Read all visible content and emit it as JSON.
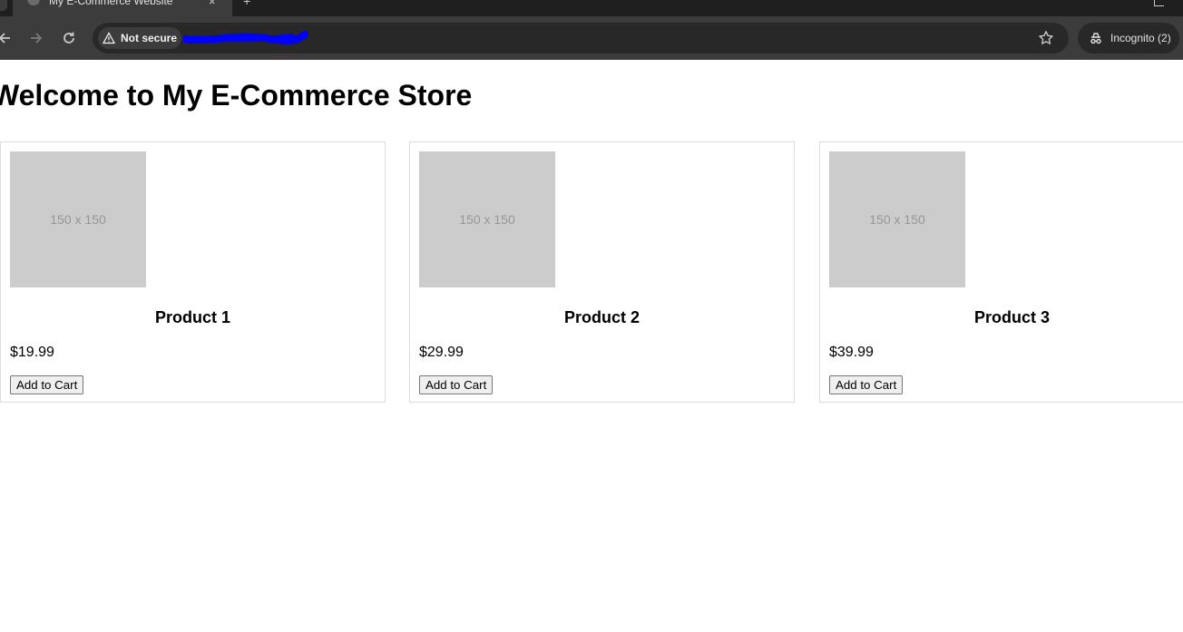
{
  "browser": {
    "tab_title": "My E-Commerce Website",
    "tab_close_glyph": "×",
    "new_tab_glyph": "+",
    "security_label": "Not secure",
    "incognito_label": "Incognito (2)",
    "icons": [
      "back-arrow-icon",
      "forward-arrow-icon",
      "reload-icon",
      "warning-icon",
      "star-icon",
      "incognito-icon"
    ]
  },
  "page": {
    "title": "Welcome to My E-Commerce Store",
    "image_placeholder_text": "150 x 150",
    "image_placeholder_color": "#cccccc",
    "products": [
      {
        "name": "Product 1",
        "price": "$19.99",
        "button_label": "Add to Cart"
      },
      {
        "name": "Product 2",
        "price": "$29.99",
        "button_label": "Add to Cart"
      },
      {
        "name": "Product 3",
        "price": "$39.99",
        "button_label": "Add to Cart"
      }
    ]
  }
}
